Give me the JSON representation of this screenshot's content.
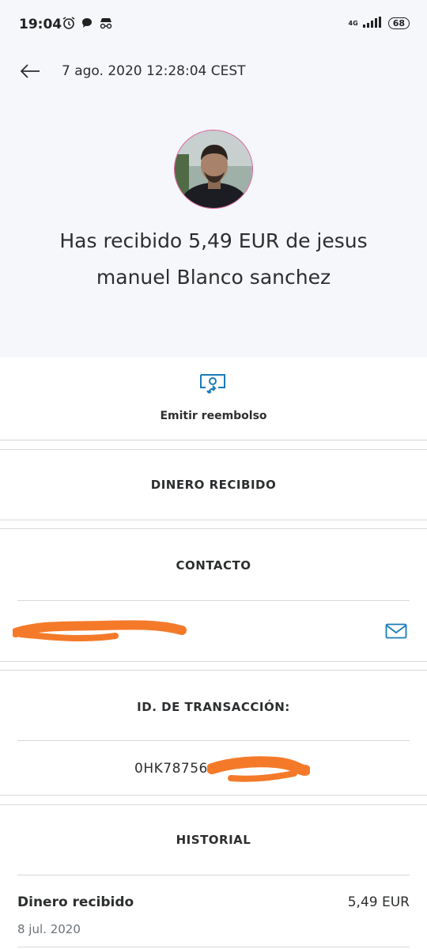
{
  "status_bar": {
    "time": "19:04",
    "network": "4G",
    "battery": "68"
  },
  "header": {
    "datetime": "7 ago. 2020 12:28:04 CEST"
  },
  "headline": "Has recibido 5,49 EUR de jesus manuel Blanco sanchez",
  "refund": {
    "label": "Emitir reembolso"
  },
  "sections": {
    "money_received": "DINERO RECIBIDO",
    "contact": "CONTACTO",
    "transaction_id_title": "ID. DE TRANSACCIÓN:",
    "transaction_id_visible": "0HK78756",
    "history": "HISTORIAL"
  },
  "history": {
    "items": [
      {
        "label": "Dinero recibido",
        "amount": "5,49 EUR",
        "date": "8 jul. 2020"
      }
    ]
  },
  "colors": {
    "accent": "#1a7bb9",
    "redaction": "#f47a2a",
    "avatar_ring": "#e05d9b"
  }
}
